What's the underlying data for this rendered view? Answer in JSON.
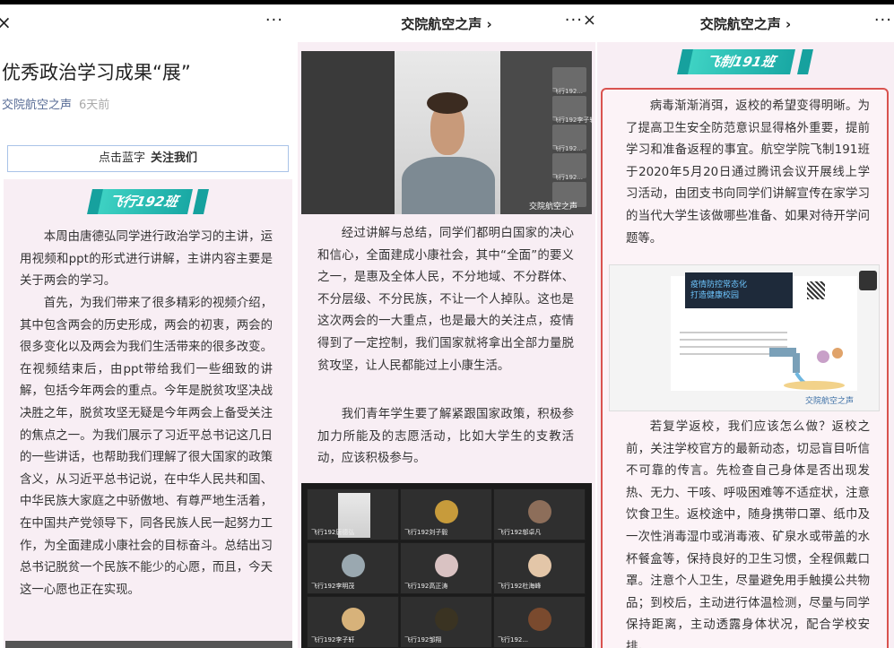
{
  "panel1": {
    "nav_close": "×",
    "nav_more": "···",
    "article_title": "优秀政治学习成果“展”",
    "author": "交院航空之声",
    "time": "6天前",
    "follow_prefix": "点击蓝字",
    "follow_bold": "关注我们",
    "banner": "飞行192班",
    "paragraphs": [
      "本周由唐德弘同学进行政治学习的主讲，运用视频和ppt的形式进行讲解，主讲内容主要是关于两会的学习。",
      "首先，为我们带来了很多精彩的视频介绍，其中包含两会的历史形成，两会的初衷，两会的很多变化以及两会为我们生活带来的很多改变。在视频结束后，由ppt带给我们一些细致的讲解，包括今年两会的重点。今年是脱贫攻坚决战决胜之年，脱贫攻坚无疑是今年两会上备受关注的焦点之一。为我们展示了习近平总书记这几日的一些讲话，也帮助我们理解了很大国家的政策含义，从习近平总书记说，在中华人民共和国、中华民族大家庭之中骄傲地、有尊严地生活着，在中国共产党领导下，同各民族人民一起努力工作，为全面建成小康社会的目标奋斗。总结出习总书记脱贫一个民族不能少的心愿，而且，今天这一心愿也正在实现。"
    ]
  },
  "panel2": {
    "nav_title": "交院航空之声 ›",
    "nav_more": "···×",
    "watermark": "交院航空之声",
    "thumb_labels": [
      "飞行192...",
      "飞行192李子轩",
      "飞行192...",
      "飞行192...",
      "飞行192..."
    ],
    "paragraphs": [
      "经过讲解与总结，同学们都明白国家的决心和信心，全面建成小康社会，其中“全面”的要义之一，是惠及全体人民，不分地域、不分群体、不分层级、不分民族，不让一个人掉队。这也是这次两会的一大重点，也是最大的关注点，疫情得到了一定控制，我们国家就将拿出全部力量脱贫攻坚，让人民都能过上小康生活。",
      "我们青年学生要了解紧跟国家政策，积极参加力所能及的志愿活动，比如大学生的支教活动，应该积极参与。"
    ],
    "grid_labels": [
      "飞行192唐德弘",
      "飞行192刘子毅",
      "飞行192邬卓凡",
      "飞行192李明茂",
      "飞行192高正涛",
      "飞行192杜海峰",
      "飞行192李子轩",
      "飞行192邹翔",
      "飞行192..."
    ]
  },
  "panel3": {
    "nav_title": "交院航空之声 ›",
    "nav_more": "···",
    "banner": "飞制191班",
    "slide_heading": "疫情防控常态化\n打造健康校园",
    "slide_watermark": "交院航空之声",
    "paragraphs": [
      "病毒渐渐消弭，返校的希望变得明晰。为了提高卫生安全防范意识显得格外重要，提前学习和准备返程的事宜。航空学院飞制191班于2020年5月20日通过腾讯会议开展线上学习活动，由团支书向同学们讲解宣传在家学习的当代大学生该做哪些准备、如果对待开学问题等。",
      "若复学返校，我们应该怎么做？返校之前，关注学校官方的最新动态，切忌盲目听信不可靠的传言。先检查自己身体是否出现发热、无力、干咳、呼吸困难等不适症状，注意饮食卫生。返校途中，随身携带口罩、纸巾及一次性消毒湿巾或消毒液、矿泉水或带盖的水杯餐盒等，保持良好的卫生习惯，全程佩戴口罩。注意个人卫生，尽量避免用手触摸公共物品；到校后，主动进行体温检测，尽量与同学保持距离，主动透露身体状况，配合学校安排。"
    ]
  },
  "colors": {
    "banner_teal": "#19a8a4",
    "author_link": "#576b95",
    "red_frame": "#d9534f",
    "pink_bg": "#f8eef4"
  }
}
